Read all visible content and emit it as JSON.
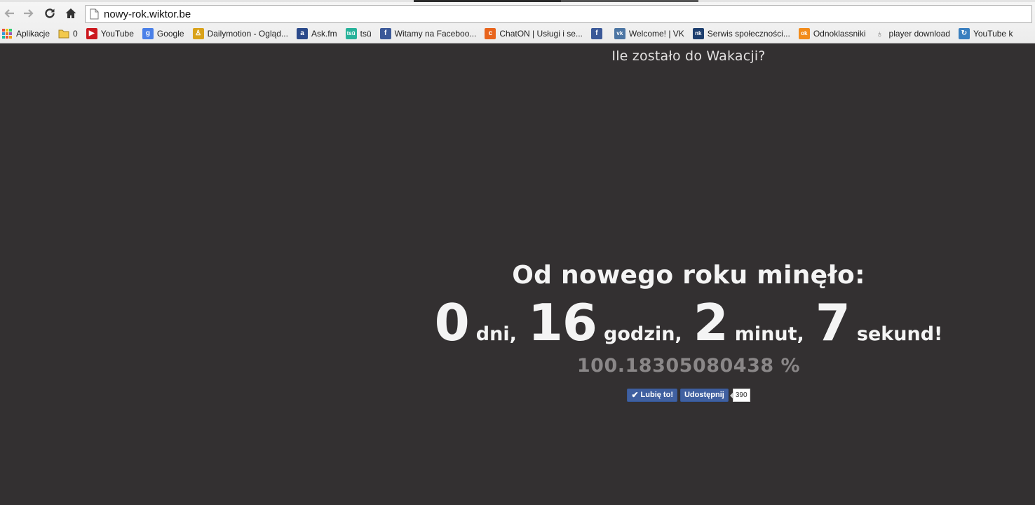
{
  "browser": {
    "url": "nowy-rok.wiktor.be",
    "bookmarks": [
      {
        "label": "Aplikacje",
        "icon": "apps-grid-icon",
        "color": "#e74c3c"
      },
      {
        "label": "0",
        "icon": "folder-icon",
        "color": "#f2c94c"
      },
      {
        "label": "YouTube",
        "icon": "youtube-icon",
        "color": "#cc181e"
      },
      {
        "label": "Google",
        "icon": "google-icon",
        "color": "#4a80e8"
      },
      {
        "label": "Dailymotion - Ogląd...",
        "icon": "dailymotion-icon",
        "color": "#d9a21a"
      },
      {
        "label": "Ask.fm",
        "icon": "askfm-icon",
        "color": "#2b4a8b"
      },
      {
        "label": "tsū",
        "icon": "tsu-icon",
        "color": "#27b29a"
      },
      {
        "label": "Witamy na Faceboo...",
        "icon": "facebook-icon",
        "color": "#3b5998"
      },
      {
        "label": "ChatON | Usługi i se...",
        "icon": "chaton-icon",
        "color": "#e8641c"
      },
      {
        "label": "",
        "icon": "facebook-icon",
        "color": "#3b5998"
      },
      {
        "label": "Welcome! | VK",
        "icon": "vk-icon",
        "color": "#4c75a3"
      },
      {
        "label": "Serwis społeczności...",
        "icon": "nk-icon",
        "color": "#1d3e6e"
      },
      {
        "label": "Odnoklassniki",
        "icon": "odnoklassniki-icon",
        "color": "#f28c1b"
      },
      {
        "label": "player download",
        "icon": "player-icon",
        "color": "#888888"
      },
      {
        "label": "YouTube k",
        "icon": "youtube-converter-icon",
        "color": "#3a7fbf"
      }
    ]
  },
  "page": {
    "nav_link": "Ile zostało do Wakacji?",
    "headline": "Od nowego roku minęło:",
    "days": "0",
    "days_unit": "dni,",
    "hours": "16",
    "hours_unit": "godzin,",
    "minutes": "2",
    "minutes_unit": "minut,",
    "seconds": "7",
    "seconds_unit": "sekund!",
    "percent": "100.18305080438 %",
    "social": {
      "like_label": "Lubię to!",
      "share_label": "Udostępnij",
      "count": "390"
    }
  },
  "colors": {
    "page_background": "#333031",
    "text": "#f4f4f4",
    "percent_text": "#8a8788",
    "facebook_blue": "#4060a0"
  }
}
